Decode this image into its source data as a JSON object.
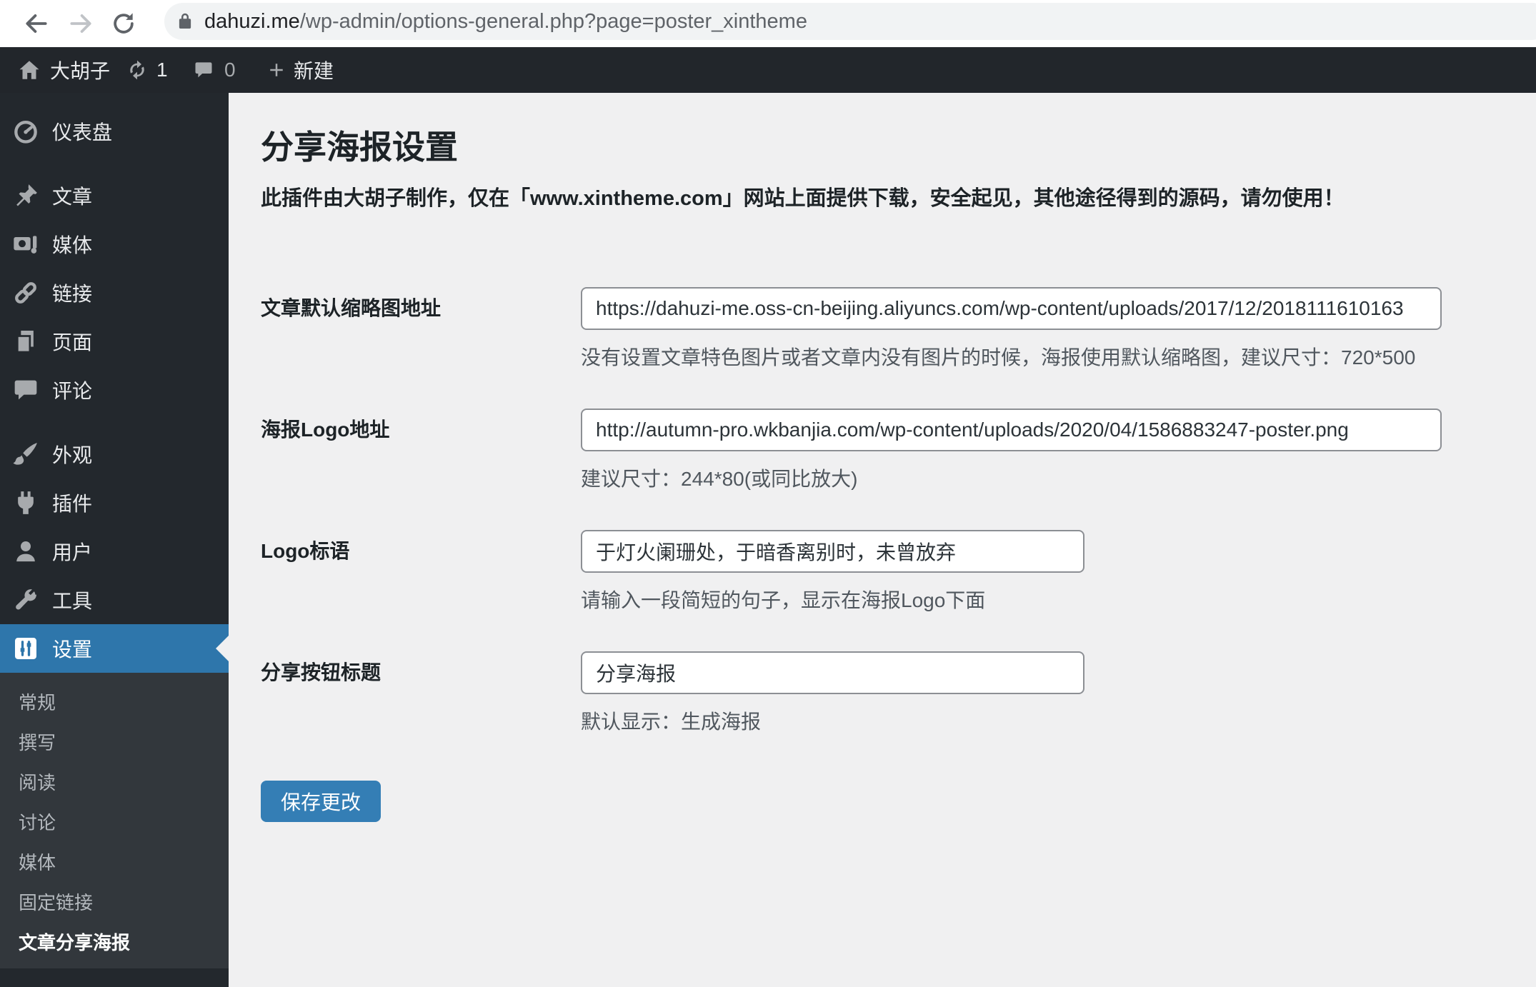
{
  "browser": {
    "url_domain": "dahuzi.me",
    "url_path": "/wp-admin/options-general.php?page=poster_xintheme"
  },
  "admin_bar": {
    "site_name": "大胡子",
    "update_count": "1",
    "comment_count": "0",
    "new_label": "新建"
  },
  "sidebar": {
    "menu": [
      {
        "label": "仪表盘",
        "icon": "dashboard-icon"
      },
      {
        "label": "文章",
        "icon": "pushpin-icon"
      },
      {
        "label": "媒体",
        "icon": "media-icon"
      },
      {
        "label": "链接",
        "icon": "link-icon"
      },
      {
        "label": "页面",
        "icon": "pages-icon"
      },
      {
        "label": "评论",
        "icon": "comments-icon"
      },
      {
        "label": "外观",
        "icon": "appearance-icon"
      },
      {
        "label": "插件",
        "icon": "plugin-icon"
      },
      {
        "label": "用户",
        "icon": "users-icon"
      },
      {
        "label": "工具",
        "icon": "tools-icon"
      },
      {
        "label": "设置",
        "icon": "settings-icon"
      }
    ],
    "submenu": [
      "常规",
      "撰写",
      "阅读",
      "讨论",
      "媒体",
      "固定链接",
      "文章分享海报"
    ],
    "active_item": "设置",
    "current_subitem": "文章分享海报"
  },
  "main": {
    "title": "分享海报设置",
    "notice": "此插件由大胡子制作，仅在「www.xintheme.com」网站上面提供下载，安全起见，其他途径得到的源码，请勿使用！",
    "fields": [
      {
        "label": "文章默认缩略图地址",
        "value": "https://dahuzi-me.oss-cn-beijing.aliyuncs.com/wp-content/uploads/2017/12/2018111610163",
        "help": "没有设置文章特色图片或者文章内没有图片的时候，海报使用默认缩略图，建议尺寸：720*500"
      },
      {
        "label": "海报Logo地址",
        "value": "http://autumn-pro.wkbanjia.com/wp-content/uploads/2020/04/1586883247-poster.png",
        "help": "建议尺寸：244*80(或同比放大)"
      },
      {
        "label": "Logo标语",
        "value": "于灯火阑珊处，于暗香离别时，未曾放弃",
        "help": "请输入一段简短的句子，显示在海报Logo下面"
      },
      {
        "label": "分享按钮标题",
        "value": "分享海报",
        "help": "默认显示：生成海报"
      }
    ],
    "save_label": "保存更改"
  },
  "colors": {
    "admin_bar_bg": "#22262b",
    "sidebar_bg": "#23282d",
    "submenu_bg": "#32373c",
    "active_menu_blue": "#2e76ab",
    "button_blue": "#347eb5",
    "content_bg": "#f0f0f1"
  }
}
